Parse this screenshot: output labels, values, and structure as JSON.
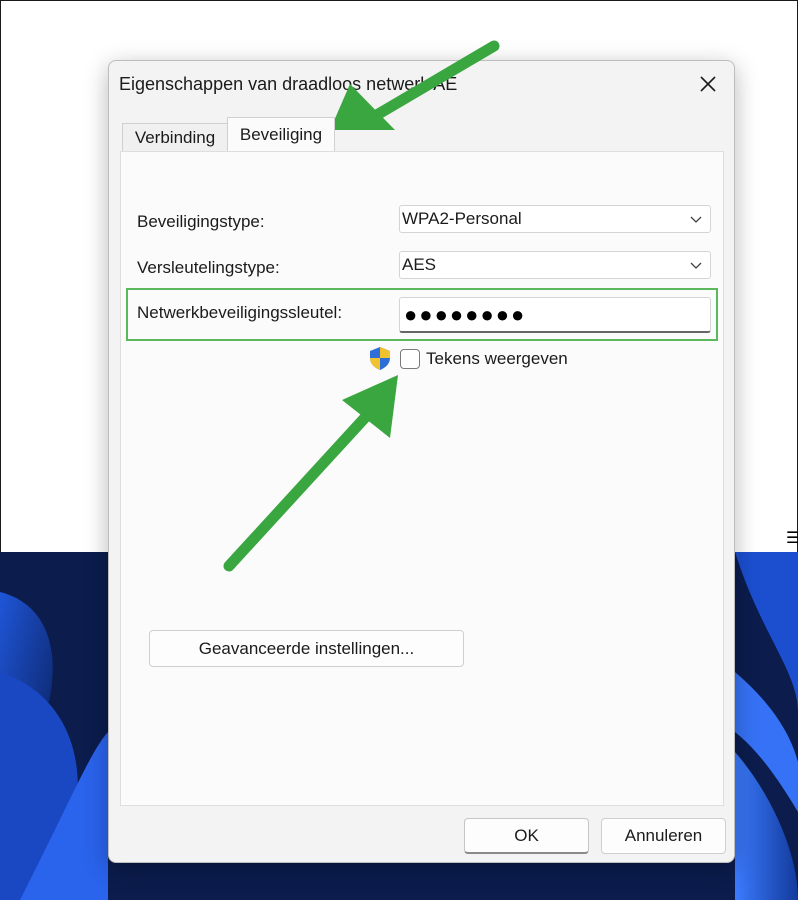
{
  "dialog": {
    "title": "Eigenschappen van draadloos netwerk AE",
    "tabs": [
      {
        "label": "Verbinding",
        "active": false
      },
      {
        "label": "Beveiliging",
        "active": true
      }
    ],
    "security_type": {
      "label": "Beveiligingstype:",
      "value": "WPA2-Personal"
    },
    "encryption_type": {
      "label": "Versleutelingstype:",
      "value": "AES"
    },
    "network_key": {
      "label": "Netwerkbeveiligingssleutel:",
      "value": "●●●●●●●●"
    },
    "show_characters": {
      "label": "Tekens weergeven",
      "checked": false
    },
    "advanced_button": "Geavanceerde instellingen...",
    "ok_button": "OK",
    "cancel_button": "Annuleren"
  },
  "icons": {
    "close": "close-icon",
    "dropdown": "chevron-down-icon",
    "uac": "uac-shield-icon",
    "side": "hamburger-icon"
  },
  "colors": {
    "highlight": "#5cb85c",
    "arrow": "#3aa63f",
    "wallpaper": "#0d2a6e"
  }
}
